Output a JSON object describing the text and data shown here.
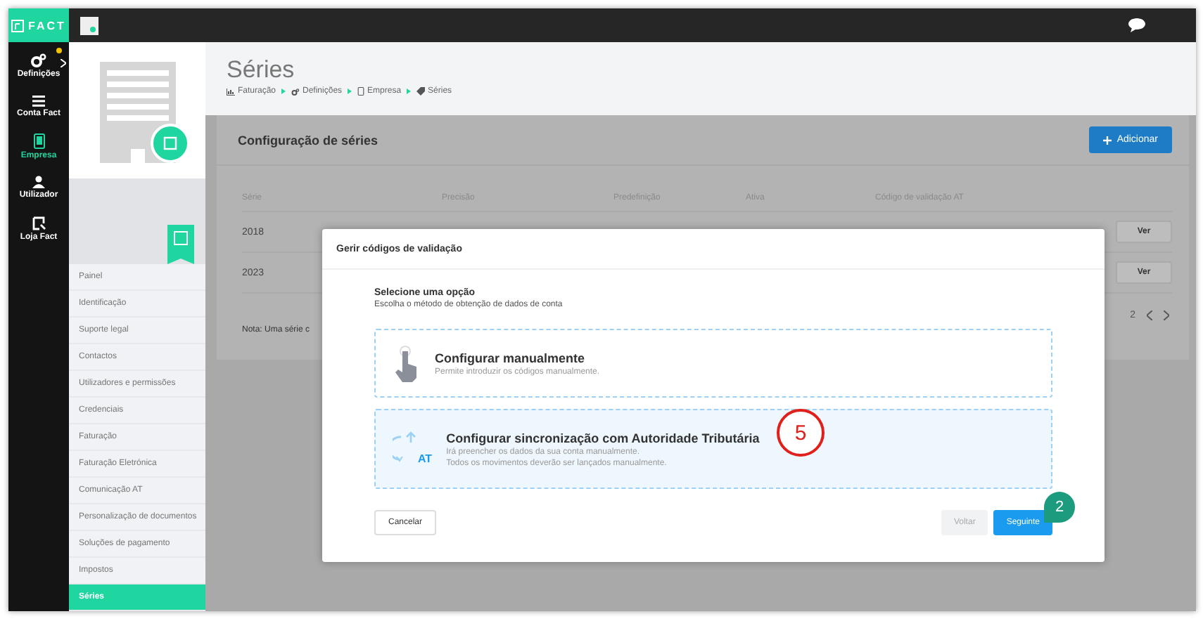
{
  "top_bar": {
    "logo": "FACT"
  },
  "rail": [
    {
      "label": "Definições",
      "kind": "gears",
      "selected": false,
      "notification": true
    },
    {
      "label": "Conta Fact",
      "kind": "menu",
      "selected": false,
      "notification": false
    },
    {
      "label": "Empresa",
      "kind": "tablet",
      "selected": true,
      "notification": false
    },
    {
      "label": "Utilizador",
      "kind": "user",
      "selected": false,
      "notification": false
    },
    {
      "label": "Loja Fact",
      "kind": "store",
      "selected": false,
      "notification": false
    }
  ],
  "company_menu": [
    {
      "label": "Painel",
      "selected": false
    },
    {
      "label": "Identificação",
      "selected": false
    },
    {
      "label": "Suporte legal",
      "selected": false
    },
    {
      "label": "Contactos",
      "selected": false
    },
    {
      "label": "Utilizadores e permissões",
      "selected": false
    },
    {
      "label": "Credenciais",
      "selected": false
    },
    {
      "label": "Faturação",
      "selected": false
    },
    {
      "label": "Faturação Eletrónica",
      "selected": false
    },
    {
      "label": "Comunicação AT",
      "selected": false
    },
    {
      "label": "Personalização de documentos",
      "selected": false
    },
    {
      "label": "Soluções de pagamento",
      "selected": false
    },
    {
      "label": "Impostos",
      "selected": false
    },
    {
      "label": "Séries",
      "selected": true
    }
  ],
  "page": {
    "title": "Séries",
    "breadcrumb": [
      {
        "label": "Faturação",
        "kind": "chart"
      },
      {
        "label": "Definições",
        "kind": "gears"
      },
      {
        "label": "Empresa",
        "kind": "tablet"
      },
      {
        "label": "Séries",
        "kind": "tag"
      }
    ]
  },
  "card": {
    "title": "Configuração de séries",
    "add_button": "Adicionar",
    "table": {
      "columns": [
        "Série",
        "Precisão",
        "Predefinição",
        "Ativa",
        "Código de validação AT"
      ],
      "rows": [
        {
          "serie": "2018",
          "action": "Ver"
        },
        {
          "serie": "2023",
          "action": "Ver"
        }
      ]
    },
    "pagination": "2",
    "note": "Nota: Uma série c"
  },
  "modal": {
    "title": "Gerir códigos de validação",
    "heading": "Selecione uma opção",
    "subheading": "Escolha o método de obtenção de dados de conta",
    "options": [
      {
        "kind": "manual",
        "title": "Configurar manualmente",
        "lines": [
          "Permite introduzir os códigos manualmente."
        ],
        "selected": false
      },
      {
        "kind": "sync",
        "title": "Configurar sincronização com Autoridade Tributária",
        "badge": "AT",
        "lines": [
          "Irá preencher os dados da sua conta manualmente.",
          "Todos os movimentos deverão ser lançados manualmente."
        ],
        "selected": true
      }
    ],
    "cancel": "Cancelar",
    "back": "Voltar",
    "next": "Seguinte"
  },
  "annotations": [
    {
      "kind": "circle",
      "label": "5"
    },
    {
      "kind": "bubble",
      "label": "2"
    }
  ]
}
